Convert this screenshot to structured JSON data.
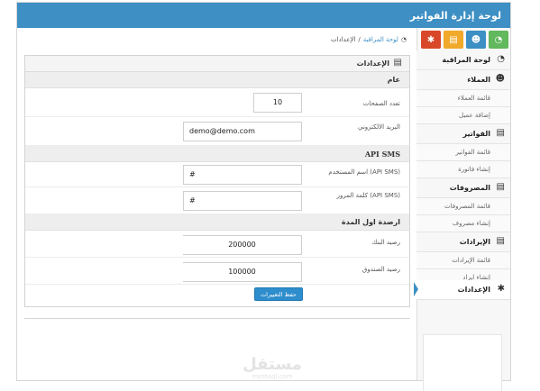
{
  "header": {
    "title": "لوحة إدارة الفواتير"
  },
  "toolbar": {
    "buttons": [
      {
        "name": "dashboard",
        "color": "#62b85c",
        "glyph": "◔"
      },
      {
        "name": "users",
        "color": "#3d8fc4",
        "glyph": "👥"
      },
      {
        "name": "clipboard",
        "color": "#f0a92b",
        "glyph": "▤"
      },
      {
        "name": "settings",
        "color": "#d9472a",
        "glyph": "✱"
      }
    ]
  },
  "sidebar": {
    "dashboard": "لوحة المراقبة",
    "clients": "العملاء",
    "clients_list": "قائمة العملاء",
    "clients_add": "إضافة عميل",
    "invoices": "الفواتير",
    "invoices_list": "قائمة الفواتير",
    "invoices_create": "إنشاء فاتورة",
    "expenses": "المصروفات",
    "expenses_list": "قائمة المصروفات",
    "expenses_create": "إنشاء مصروف",
    "revenues": "الإيرادات",
    "revenues_list": "قائمة الإيرادات",
    "revenues_create": "إنشاء ايراد",
    "settings": "الإعدادات"
  },
  "breadcrumb": {
    "home": "لوحة المراقبة",
    "separator": "/",
    "current": "الإعدادات"
  },
  "panel": {
    "title": "الإعدادات",
    "general_section": "عام",
    "pages_label": "تعدد الصفحات",
    "pages_value": "10",
    "email_label": "البريد الالكتروني",
    "email_value": "demo@demo.com",
    "sms_section": "API SMS",
    "sms_user_label": "اسم المستخدم (API SMS)",
    "sms_user_value": "#",
    "sms_pass_label": "كلمة المرور (API SMS)",
    "sms_pass_value": "#",
    "opening_section": "ارصدة اول المدة",
    "bank_label": "رصيد البنك",
    "bank_value": "200000",
    "cash_label": "رصيد الصندوق",
    "cash_value": "100000",
    "save_label": "حفظ التغييرات"
  },
  "watermark": {
    "main": "مستقل",
    "sub": "mostaql.com"
  }
}
